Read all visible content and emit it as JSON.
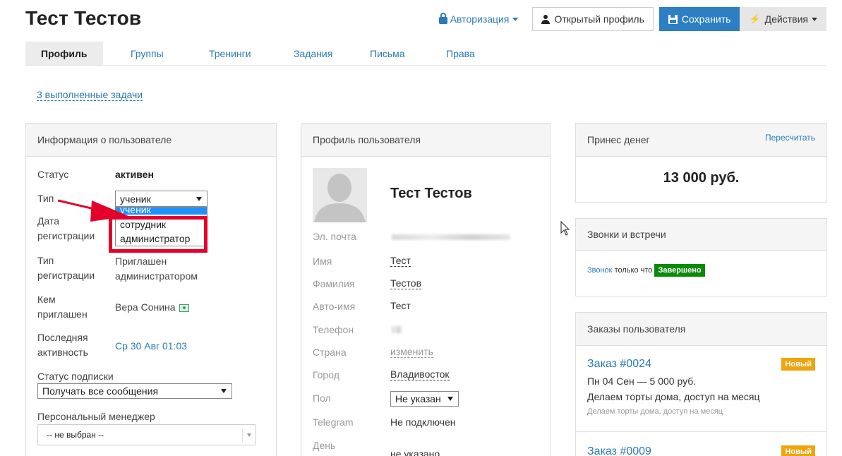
{
  "header": {
    "title": "Тест Тестов",
    "auth_label": "Авторизация",
    "open_profile_label": "Открытый профиль",
    "save_label": "Сохранить",
    "actions_label": "Действия",
    "accent_color": "#2d7fc4"
  },
  "tabs": [
    {
      "label": "Профиль",
      "active": true
    },
    {
      "label": "Группы"
    },
    {
      "label": "Тренинги"
    },
    {
      "label": "Задания"
    },
    {
      "label": "Письма"
    },
    {
      "label": "Права"
    }
  ],
  "tasks_link": "3 выполненные задачи",
  "user_info": {
    "title": "Информация о пользователе",
    "status_label": "Статус",
    "status_value": "активен",
    "type_label": "Тип",
    "type_value": "ученик",
    "type_options": [
      "ученик",
      "сотрудник",
      "администратор"
    ],
    "reg_date_label_1": "Дата",
    "reg_date_label_2": "регистрации",
    "reg_type_label_1": "Тип",
    "reg_type_label_2": "регистрации",
    "reg_type_value_1": "Приглашен",
    "reg_type_value_2": "администратором",
    "invited_by_label_1": "Кем",
    "invited_by_label_2": "приглашен",
    "invited_by_value": "Вера Сонина",
    "last_activity_label_1": "Последняя",
    "last_activity_label_2": "активность",
    "last_activity_value": "Ср 30 Авг 01:03",
    "subscription_label": "Статус подписки",
    "subscription_value": "Получать все сообщения",
    "manager_label": "Персональный менеджер",
    "manager_value": "-- не выбран --"
  },
  "profile": {
    "title": "Профиль пользователя",
    "name": "Тест Тестов",
    "email_label": "Эл. почта",
    "first_name_label": "Имя",
    "first_name_value": "Тест",
    "last_name_label": "Фамилия",
    "last_name_value": "Тестов",
    "auto_name_label": "Авто-имя",
    "auto_name_value": "Тест",
    "phone_label": "Телефон",
    "country_label": "Страна",
    "country_value": "изменить",
    "city_label": "Город",
    "city_value": "Владивосток",
    "gender_label": "Пол",
    "gender_value": "Не указан",
    "telegram_label": "Telegram",
    "telegram_value": "Не подключен",
    "birthday_label": "День",
    "birthday_value": "не указано"
  },
  "money": {
    "title": "Принес денег",
    "recount_label": "Пересчитать",
    "amount": "13 000 руб."
  },
  "calls": {
    "title": "Звонки и встречи",
    "call_link": "Звонок",
    "call_time": "только что",
    "call_status": "Завершено"
  },
  "orders": {
    "title": "Заказы пользователя",
    "items": [
      {
        "number": "Заказ #0024",
        "badge": "Новый",
        "date_line": "Пн 04 Сен — 5 000 руб.",
        "product": "Делаем торты дома, доступ на месяц",
        "subtitle": "Делаем торты дома, доступ на месяц"
      },
      {
        "number": "Заказ #0009",
        "badge": "Новый"
      }
    ]
  }
}
